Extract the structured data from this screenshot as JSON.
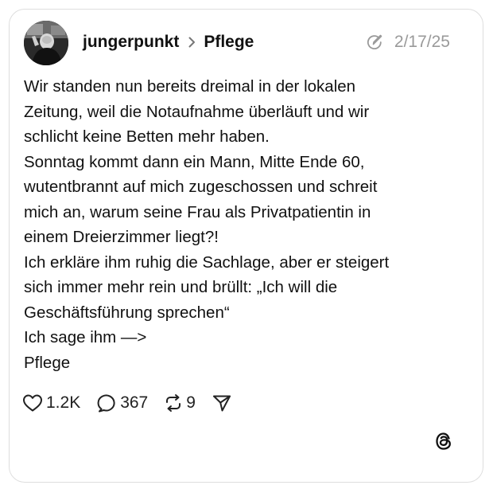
{
  "post": {
    "username": "jungerpunkt",
    "topic": "Pflege",
    "date": "2/17/25",
    "body_lines": [
      "Wir standen nun bereits dreimal in der lokalen",
      "Zeitung, weil die Notaufnahme überläuft und wir",
      "schlicht keine Betten mehr haben.",
      "Sonntag kommt dann ein Mann, Mitte Ende 60,",
      "wutentbrannt auf mich zugeschossen und schreit",
      "mich an, warum seine Frau als Privatpatientin in",
      "einem Dreierzimmer liegt?!",
      "Ich erkläre ihm ruhig die Sachlage, aber er steigert",
      "sich immer mehr rein und brüllt: „Ich will die",
      "Geschäftsführung sprechen“",
      "Ich sage ihm —>",
      "Pflege"
    ]
  },
  "actions": {
    "likes": "1.2K",
    "replies": "367",
    "reposts": "9"
  },
  "icons": {
    "topic_separator": "chevron-right-icon",
    "edited": "edited-pencil-icon",
    "like": "heart-icon",
    "reply": "comment-bubble-icon",
    "repost": "repost-icon",
    "share": "send-icon",
    "brand": "threads-logo-icon"
  },
  "colors": {
    "text": "#111111",
    "muted": "#9a9a9a",
    "border": "#dedede",
    "background": "#ffffff"
  }
}
